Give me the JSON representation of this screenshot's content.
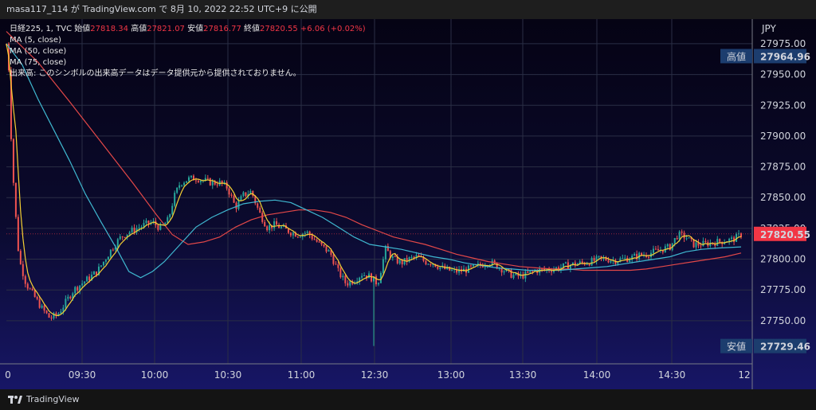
{
  "header": {
    "user": "masa117_114",
    "connector": "が",
    "site": "TradingView.com",
    "connector2": "で",
    "datetime": "8月 10, 2022 22:52 UTC+9",
    "suffix": "に公開"
  },
  "legend": {
    "symbol": "日経225, 1, TVC",
    "open_label": "始値",
    "open": "27818.34",
    "high_label": "高値",
    "high": "27821.07",
    "low_label": "安値",
    "low": "27816.77",
    "close_label": "終値",
    "close": "27820.55",
    "change": "+6.06 (+0.02%)",
    "ma5": "MA (5, close)",
    "ma50": "MA (50, close)",
    "ma75": "MA (75, close)",
    "volume_note": "出来高: このシンボルの出来高データはデータ提供元から提供されておりません。"
  },
  "footer": {
    "brand": "TradingView"
  },
  "colors": {
    "up": "#26a69a",
    "down": "#ef5350",
    "ma5": "#f5d033",
    "ma50": "#3fb8d0",
    "ma75": "#e34848",
    "price_tag": "#f23645",
    "hl_tag": "#1c3d6e"
  },
  "chart_data": {
    "type": "candlestick",
    "currency": "JPY",
    "y_ticks": [
      27729.46,
      27750,
      27775,
      27800,
      27825,
      27850,
      27875,
      27900,
      27925,
      27950,
      27975
    ],
    "y_tick_labels": [
      "27729.46",
      "27750.00",
      "27775.00",
      "27800.00",
      "27825.00",
      "27850.00",
      "27875.00",
      "27900.00",
      "27925.00",
      "27950.00",
      "27975.00"
    ],
    "ylim": [
      27715,
      27995
    ],
    "x_ticks": [
      "0",
      "09:30",
      "10:00",
      "10:30",
      "11:00",
      "12:30",
      "13:00",
      "13:30",
      "14:00",
      "14:30",
      "12"
    ],
    "high_label": "高値",
    "high_value": 27964.96,
    "low_label": "安値",
    "low_value": 27729.46,
    "last_price": 27820.55,
    "last_price_label": "27820.55",
    "high_value_label": "27964.96",
    "low_value_label": "27729.46",
    "close_path": [
      [
        0,
        27975
      ],
      [
        3,
        27955
      ],
      [
        6,
        27900
      ],
      [
        10,
        27850
      ],
      [
        16,
        27800
      ],
      [
        25,
        27780
      ],
      [
        35,
        27770
      ],
      [
        45,
        27760
      ],
      [
        55,
        27752
      ],
      [
        65,
        27755
      ],
      [
        75,
        27765
      ],
      [
        85,
        27775
      ],
      [
        95,
        27780
      ],
      [
        105,
        27785
      ],
      [
        115,
        27790
      ],
      [
        125,
        27800
      ],
      [
        135,
        27810
      ],
      [
        145,
        27818
      ],
      [
        155,
        27822
      ],
      [
        165,
        27825
      ],
      [
        175,
        27828
      ],
      [
        185,
        27830
      ],
      [
        195,
        27825
      ],
      [
        205,
        27832
      ],
      [
        212,
        27850
      ],
      [
        220,
        27862
      ],
      [
        230,
        27865
      ],
      [
        240,
        27866
      ],
      [
        250,
        27864
      ],
      [
        260,
        27862
      ],
      [
        270,
        27862
      ],
      [
        280,
        27858
      ],
      [
        290,
        27842
      ],
      [
        300,
        27852
      ],
      [
        310,
        27855
      ],
      [
        320,
        27838
      ],
      [
        330,
        27826
      ],
      [
        340,
        27828
      ],
      [
        350,
        27825
      ],
      [
        360,
        27822
      ],
      [
        370,
        27820
      ],
      [
        380,
        27822
      ],
      [
        390,
        27816
      ],
      [
        400,
        27810
      ],
      [
        410,
        27805
      ],
      [
        420,
        27790
      ],
      [
        430,
        27780
      ],
      [
        440,
        27783
      ],
      [
        450,
        27788
      ],
      [
        460,
        27786
      ],
      [
        470,
        27780
      ],
      [
        480,
        27808
      ],
      [
        490,
        27800
      ],
      [
        500,
        27797
      ],
      [
        510,
        27800
      ],
      [
        520,
        27802
      ],
      [
        530,
        27798
      ],
      [
        540,
        27797
      ],
      [
        550,
        27793
      ],
      [
        560,
        27791
      ],
      [
        570,
        27790
      ],
      [
        580,
        27791
      ],
      [
        590,
        27793
      ],
      [
        600,
        27795
      ],
      [
        610,
        27798
      ],
      [
        620,
        27795
      ],
      [
        630,
        27791
      ],
      [
        640,
        27787
      ],
      [
        650,
        27786
      ],
      [
        660,
        27788
      ],
      [
        670,
        27791
      ],
      [
        680,
        27791
      ],
      [
        690,
        27792
      ],
      [
        700,
        27793
      ],
      [
        710,
        27795
      ],
      [
        720,
        27796
      ],
      [
        730,
        27797
      ],
      [
        740,
        27798
      ],
      [
        750,
        27800
      ],
      [
        760,
        27800
      ],
      [
        770,
        27799
      ],
      [
        780,
        27800
      ],
      [
        790,
        27801
      ],
      [
        800,
        27803
      ],
      [
        810,
        27804
      ],
      [
        820,
        27806
      ],
      [
        830,
        27808
      ],
      [
        840,
        27810
      ],
      [
        850,
        27820
      ],
      [
        860,
        27818
      ],
      [
        870,
        27812
      ],
      [
        880,
        27812
      ],
      [
        890,
        27813
      ],
      [
        900,
        27814
      ],
      [
        910,
        27815
      ],
      [
        920,
        27816
      ],
      [
        930,
        27820
      ]
    ],
    "ma50_path": [
      [
        0,
        27975
      ],
      [
        20,
        27958
      ],
      [
        40,
        27930
      ],
      [
        60,
        27905
      ],
      [
        80,
        27880
      ],
      [
        100,
        27853
      ],
      [
        120,
        27830
      ],
      [
        140,
        27808
      ],
      [
        155,
        27790
      ],
      [
        170,
        27785
      ],
      [
        185,
        27790
      ],
      [
        200,
        27798
      ],
      [
        220,
        27812
      ],
      [
        240,
        27826
      ],
      [
        260,
        27834
      ],
      [
        280,
        27840
      ],
      [
        300,
        27845
      ],
      [
        320,
        27847
      ],
      [
        340,
        27848
      ],
      [
        360,
        27846
      ],
      [
        380,
        27840
      ],
      [
        400,
        27834
      ],
      [
        420,
        27826
      ],
      [
        440,
        27818
      ],
      [
        460,
        27812
      ],
      [
        480,
        27810
      ],
      [
        500,
        27808
      ],
      [
        520,
        27805
      ],
      [
        540,
        27802
      ],
      [
        560,
        27800
      ],
      [
        580,
        27797
      ],
      [
        600,
        27795
      ],
      [
        620,
        27793
      ],
      [
        640,
        27792
      ],
      [
        660,
        27791
      ],
      [
        680,
        27791
      ],
      [
        700,
        27791
      ],
      [
        720,
        27792
      ],
      [
        740,
        27793
      ],
      [
        760,
        27794
      ],
      [
        780,
        27796
      ],
      [
        800,
        27798
      ],
      [
        820,
        27800
      ],
      [
        840,
        27802
      ],
      [
        860,
        27806
      ],
      [
        880,
        27808
      ],
      [
        900,
        27809
      ],
      [
        930,
        27810
      ]
    ],
    "ma75_path": [
      [
        0,
        27985
      ],
      [
        40,
        27960
      ],
      [
        80,
        27928
      ],
      [
        120,
        27895
      ],
      [
        160,
        27862
      ],
      [
        190,
        27836
      ],
      [
        210,
        27820
      ],
      [
        230,
        27812
      ],
      [
        250,
        27814
      ],
      [
        270,
        27818
      ],
      [
        290,
        27826
      ],
      [
        310,
        27832
      ],
      [
        330,
        27836
      ],
      [
        350,
        27838
      ],
      [
        370,
        27840
      ],
      [
        390,
        27840
      ],
      [
        410,
        27838
      ],
      [
        430,
        27834
      ],
      [
        450,
        27828
      ],
      [
        470,
        27823
      ],
      [
        490,
        27818
      ],
      [
        510,
        27815
      ],
      [
        530,
        27812
      ],
      [
        550,
        27808
      ],
      [
        570,
        27804
      ],
      [
        590,
        27801
      ],
      [
        610,
        27798
      ],
      [
        630,
        27796
      ],
      [
        650,
        27794
      ],
      [
        670,
        27793
      ],
      [
        690,
        27792
      ],
      [
        710,
        27792
      ],
      [
        730,
        27791
      ],
      [
        750,
        27791
      ],
      [
        770,
        27791
      ],
      [
        790,
        27791
      ],
      [
        810,
        27792
      ],
      [
        830,
        27794
      ],
      [
        850,
        27796
      ],
      [
        870,
        27798
      ],
      [
        890,
        27800
      ],
      [
        910,
        27802
      ],
      [
        930,
        27805
      ]
    ]
  }
}
